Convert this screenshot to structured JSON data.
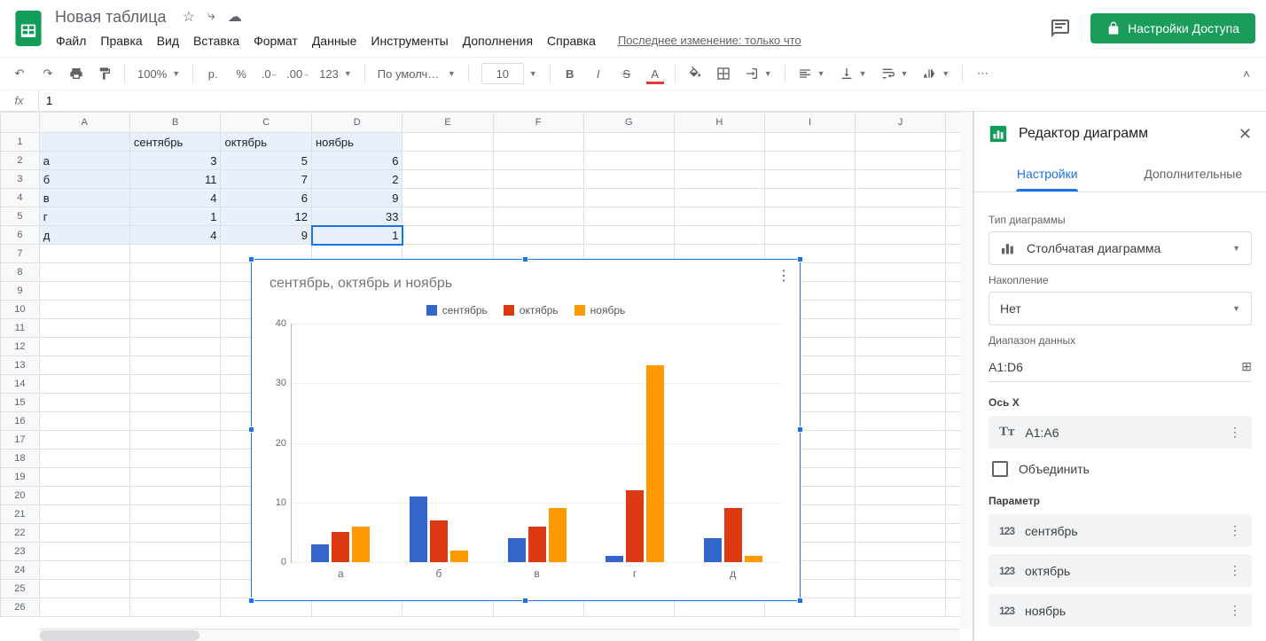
{
  "doc": {
    "title": "Новая таблица",
    "last_edit": "Последнее изменение: только что"
  },
  "menu": [
    "Файл",
    "Правка",
    "Вид",
    "Вставка",
    "Формат",
    "Данные",
    "Инструменты",
    "Дополнения",
    "Справка"
  ],
  "share": "Настройки Доступа",
  "toolbar": {
    "zoom": "100%",
    "currency": "р.",
    "percent": "%",
    "dec_less": ".0",
    "dec_more": ".00",
    "fmt": "123",
    "font": "По умолча...",
    "size": "10"
  },
  "fx": {
    "label": "fx",
    "value": "1"
  },
  "columns": [
    "A",
    "B",
    "C",
    "D",
    "E",
    "F",
    "G",
    "H",
    "I",
    "J"
  ],
  "rows_shown": 26,
  "cells": {
    "headers": [
      "",
      "сентябрь",
      "октябрь",
      "ноябрь"
    ],
    "rows": [
      [
        "а",
        3,
        5,
        6
      ],
      [
        "б",
        11,
        7,
        2
      ],
      [
        "в",
        4,
        6,
        9
      ],
      [
        "г",
        1,
        12,
        33
      ],
      [
        "д",
        4,
        9,
        1
      ]
    ]
  },
  "chart_data": {
    "type": "bar",
    "title": "сентябрь, октябрь и ноябрь",
    "categories": [
      "а",
      "б",
      "в",
      "г",
      "д"
    ],
    "series": [
      {
        "name": "сентябрь",
        "values": [
          3,
          11,
          4,
          1,
          4
        ],
        "color": "#3366cc"
      },
      {
        "name": "октябрь",
        "values": [
          5,
          7,
          6,
          12,
          9
        ],
        "color": "#dc3912"
      },
      {
        "name": "ноябрь",
        "values": [
          6,
          2,
          9,
          33,
          1
        ],
        "color": "#ff9900"
      }
    ],
    "ylim": [
      0,
      40
    ],
    "yticks": [
      0,
      10,
      20,
      30,
      40
    ]
  },
  "sidebar": {
    "title": "Редактор диаграмм",
    "tabs": [
      "Настройки",
      "Дополнительные"
    ],
    "chart_type_lbl": "Тип диаграммы",
    "chart_type": "Столбчатая диаграмма",
    "stacking_lbl": "Накопление",
    "stacking": "Нет",
    "range_lbl": "Диапазон данных",
    "range": "A1:D6",
    "xaxis_lbl": "Ось X",
    "xaxis": "A1:A6",
    "combine": "Объединить",
    "series_lbl": "Параметр",
    "series": [
      "сентябрь",
      "октябрь",
      "ноябрь"
    ]
  }
}
